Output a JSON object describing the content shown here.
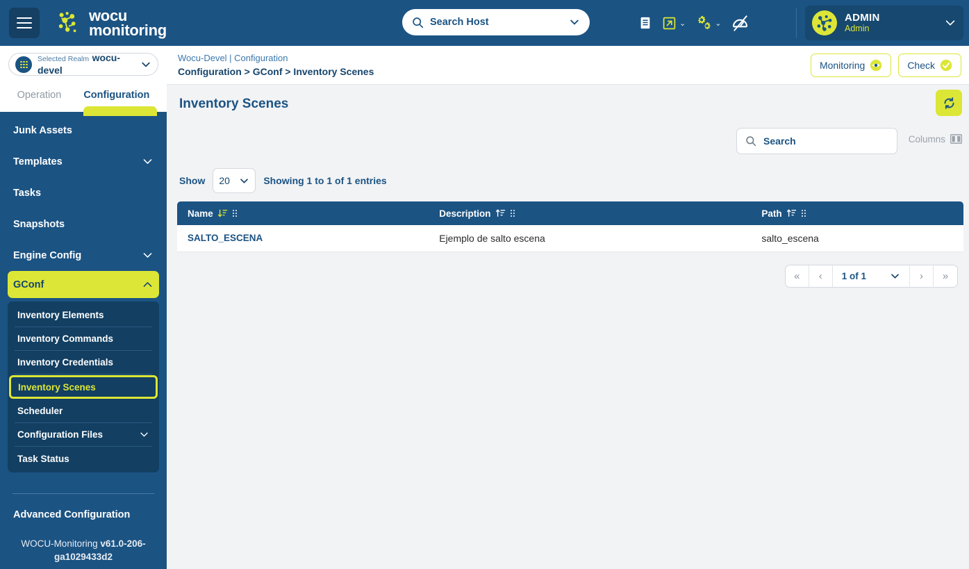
{
  "header": {
    "brand_line1": "wocu",
    "brand_line2": "monitoring",
    "menu_icon": "hamburger-icon",
    "search": {
      "placeholder": "Search Host",
      "icon": "search-icon",
      "chevron": "chevron-down-icon"
    },
    "icons": [
      {
        "name": "book-icon"
      },
      {
        "name": "external-link-icon"
      },
      {
        "name": "gears-icon"
      },
      {
        "name": "dashboard-off-icon"
      }
    ],
    "user": {
      "name": "ADMIN",
      "role": "Admin",
      "avatar": "network-avatar-icon"
    }
  },
  "sidebar": {
    "realm": {
      "label": "Selected Realm",
      "value": "wocu-devel"
    },
    "tabs": [
      {
        "label": "Operation",
        "active": false
      },
      {
        "label": "Configuration",
        "active": true
      }
    ],
    "items": [
      {
        "label": "Junk Assets",
        "expandable": false
      },
      {
        "label": "Templates",
        "expandable": true
      },
      {
        "label": "Tasks",
        "expandable": false
      },
      {
        "label": "Snapshots",
        "expandable": false
      },
      {
        "label": "Engine Config",
        "expandable": true
      },
      {
        "label": "GConf",
        "expandable": true,
        "active": true
      }
    ],
    "submenu": [
      {
        "label": "Inventory Elements",
        "expandable": false
      },
      {
        "label": "Inventory Commands",
        "expandable": false
      },
      {
        "label": "Inventory Credentials",
        "expandable": false
      },
      {
        "label": "Inventory Scenes",
        "expandable": false,
        "selected": true
      },
      {
        "label": "Scheduler",
        "expandable": false
      },
      {
        "label": "Configuration Files",
        "expandable": true
      },
      {
        "label": "Task Status",
        "expandable": false
      }
    ],
    "advanced_configuration": "Advanced Configuration",
    "version_prefix": "WOCU-Monitoring ",
    "version_value": "v61.0-206-ga1029433d2"
  },
  "breadcrumb": {
    "top": "Wocu-Devel | Configuration",
    "path": "Configuration > GConf > Inventory Scenes",
    "monitoring_label": "Monitoring",
    "check_label": "Check"
  },
  "page": {
    "title": "Inventory Scenes",
    "refresh_icon": "refresh-icon"
  },
  "toolbar": {
    "search_placeholder": "Search",
    "columns_label": "Columns",
    "columns_icon": "columns-icon",
    "show_label": "Show",
    "show_value": "20",
    "showing_text": "Showing 1 to 1 of 1 entries"
  },
  "table": {
    "columns": [
      {
        "label": "Name",
        "sort": "desc"
      },
      {
        "label": "Description",
        "sort": "asc"
      },
      {
        "label": "Path",
        "sort": "asc"
      }
    ],
    "rows": [
      {
        "name": "SALTO_ESCENA",
        "description": "Ejemplo de salto escena",
        "path": "salto_escena"
      }
    ]
  },
  "pagination": {
    "first": "«",
    "prev": "‹",
    "current": "1 of 1",
    "next": "›",
    "last": "»"
  },
  "colors": {
    "brand_blue": "#1b5383",
    "accent_yellow": "#dce636",
    "dark_blue": "#123f62",
    "page_bg": "#f2f3f5"
  }
}
